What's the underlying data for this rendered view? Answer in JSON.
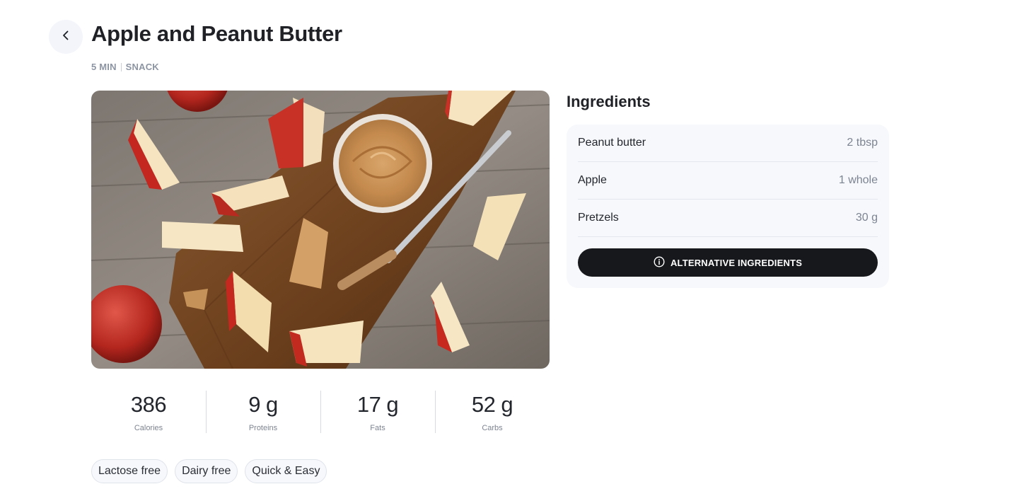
{
  "header": {
    "back_icon": "chevron-left-icon",
    "title": "Apple and Peanut Butter",
    "meta": {
      "time": "5 MIN",
      "category": "SNACK"
    }
  },
  "image": {
    "subject": "photo-apple-peanut-butter"
  },
  "nutrition": [
    {
      "value": "386",
      "label": "Calories"
    },
    {
      "value": "9 g",
      "label": "Proteins"
    },
    {
      "value": "17 g",
      "label": "Fats"
    },
    {
      "value": "52 g",
      "label": "Carbs"
    }
  ],
  "tags": [
    "Lactose free",
    "Dairy free",
    "Quick & Easy"
  ],
  "ingredients": {
    "title": "Ingredients",
    "items": [
      {
        "name": "Peanut butter",
        "qty": "2 tbsp"
      },
      {
        "name": "Apple",
        "qty": "1 whole"
      },
      {
        "name": "Pretzels",
        "qty": "30 g"
      }
    ],
    "alt_button": {
      "label": "ALTERNATIVE INGREDIENTS",
      "icon": "info-icon"
    }
  },
  "colors": {
    "background": "#ffffff",
    "card": "#f6f8fc",
    "button": "#16181c",
    "muted_text": "#8d95a3"
  }
}
